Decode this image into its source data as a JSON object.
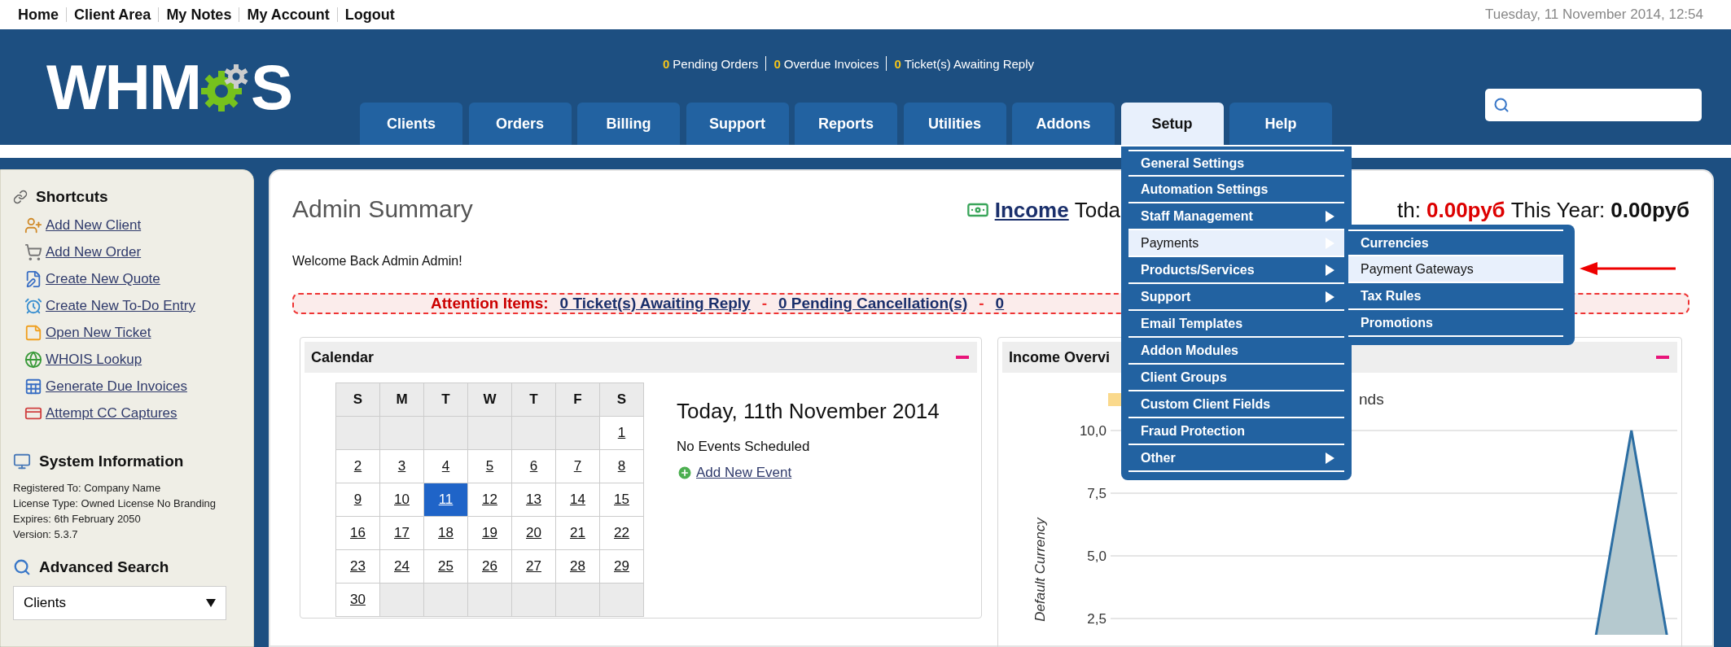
{
  "top_links": [
    "Home",
    "Client Area",
    "My Notes",
    "My Account",
    "Logout"
  ],
  "date": "Tuesday, 11 November 2014, 12:54",
  "logo": {
    "before": "WHM",
    "after": "S"
  },
  "notifications": [
    {
      "count": "0",
      "label": "Pending Orders"
    },
    {
      "count": "0",
      "label": "Overdue Invoices"
    },
    {
      "count": "0",
      "label": "Ticket(s) Awaiting Reply"
    }
  ],
  "tabs": [
    {
      "label": "Clients",
      "selected": false
    },
    {
      "label": "Orders",
      "selected": false
    },
    {
      "label": "Billing",
      "selected": false
    },
    {
      "label": "Support",
      "selected": false
    },
    {
      "label": "Reports",
      "selected": false
    },
    {
      "label": "Utilities",
      "selected": false
    },
    {
      "label": "Addons",
      "selected": false
    },
    {
      "label": "Setup",
      "selected": true
    },
    {
      "label": "Help",
      "selected": false
    }
  ],
  "setup_menu": {
    "items": [
      {
        "label": "General Settings",
        "has_submenu": false,
        "selected": false
      },
      {
        "label": "Automation Settings",
        "has_submenu": false,
        "selected": false
      },
      {
        "label": "Staff Management",
        "has_submenu": true,
        "selected": false
      },
      {
        "label": "Payments",
        "has_submenu": true,
        "selected": true
      },
      {
        "label": "Products/Services",
        "has_submenu": true,
        "selected": false
      },
      {
        "label": "Support",
        "has_submenu": true,
        "selected": false
      },
      {
        "label": "Email Templates",
        "has_submenu": false,
        "selected": false
      },
      {
        "label": "Addon Modules",
        "has_submenu": false,
        "selected": false
      },
      {
        "label": "Client Groups",
        "has_submenu": false,
        "selected": false
      },
      {
        "label": "Custom Client Fields",
        "has_submenu": false,
        "selected": false
      },
      {
        "label": "Fraud Protection",
        "has_submenu": false,
        "selected": false
      },
      {
        "label": "Other",
        "has_submenu": true,
        "selected": false
      }
    ]
  },
  "payments_submenu": {
    "items": [
      {
        "label": "Currencies",
        "selected": false
      },
      {
        "label": "Payment Gateways",
        "selected": true
      },
      {
        "label": "Tax Rules",
        "selected": false
      },
      {
        "label": "Promotions",
        "selected": false
      }
    ]
  },
  "sidebar": {
    "shortcuts": {
      "title": "Shortcuts",
      "items": [
        "Add New Client",
        "Add New Order",
        "Create New Quote",
        "Create New To-Do Entry",
        "Open New Ticket",
        "WHOIS Lookup",
        "Generate Due Invoices",
        "Attempt CC Captures"
      ]
    },
    "system_info": {
      "title": "System Information",
      "lines": [
        "Registered To: Company Name",
        "License Type: Owned License No Branding",
        "Expires: 6th February 2050",
        "Version: 5.3.7"
      ]
    },
    "advanced_search": {
      "title": "Advanced Search",
      "select_value": "Clients"
    }
  },
  "main": {
    "title": "Admin Summary",
    "income": {
      "label": "Income",
      "parts": [
        {
          "kind": "text",
          "text": "Toda"
        },
        {
          "kind": "gap"
        },
        {
          "kind": "text",
          "text": "th:"
        },
        {
          "kind": "alert_amount",
          "text": "0.00руб"
        },
        {
          "kind": "text",
          "text": "This Year:"
        },
        {
          "kind": "amount",
          "text": "0.00руб"
        }
      ]
    },
    "welcome": "Welcome Back Admin Admin!",
    "attention": {
      "label": "Attention Items:",
      "separator": "-",
      "links": [
        "0 Ticket(s) Awaiting Reply",
        "0 Pending Cancellation(s)",
        "0"
      ]
    }
  },
  "calendar": {
    "title": "Calendar",
    "weekdays": [
      "S",
      "M",
      "T",
      "W",
      "T",
      "F",
      "S"
    ],
    "weeks": [
      [
        {
          "kind": "blank"
        },
        {
          "kind": "blank"
        },
        {
          "kind": "blank"
        },
        {
          "kind": "blank"
        },
        {
          "kind": "blank"
        },
        {
          "kind": "blank"
        },
        {
          "kind": "day",
          "day": "1",
          "selected": false
        }
      ],
      [
        {
          "kind": "day",
          "day": "2",
          "selected": false
        },
        {
          "kind": "day",
          "day": "3",
          "selected": false
        },
        {
          "kind": "day",
          "day": "4",
          "selected": false
        },
        {
          "kind": "day",
          "day": "5",
          "selected": false
        },
        {
          "kind": "day",
          "day": "6",
          "selected": false
        },
        {
          "kind": "day",
          "day": "7",
          "selected": false
        },
        {
          "kind": "day",
          "day": "8",
          "selected": false
        }
      ],
      [
        {
          "kind": "day",
          "day": "9",
          "selected": false
        },
        {
          "kind": "day",
          "day": "10",
          "selected": false
        },
        {
          "kind": "day",
          "day": "11",
          "selected": true
        },
        {
          "kind": "day",
          "day": "12",
          "selected": false
        },
        {
          "kind": "day",
          "day": "13",
          "selected": false
        },
        {
          "kind": "day",
          "day": "14",
          "selected": false
        },
        {
          "kind": "day",
          "day": "15",
          "selected": false
        }
      ],
      [
        {
          "kind": "day",
          "day": "16",
          "selected": false
        },
        {
          "kind": "day",
          "day": "17",
          "selected": false
        },
        {
          "kind": "day",
          "day": "18",
          "selected": false
        },
        {
          "kind": "day",
          "day": "19",
          "selected": false
        },
        {
          "kind": "day",
          "day": "20",
          "selected": false
        },
        {
          "kind": "day",
          "day": "21",
          "selected": false
        },
        {
          "kind": "day",
          "day": "22",
          "selected": false
        }
      ],
      [
        {
          "kind": "day",
          "day": "23",
          "selected": false
        },
        {
          "kind": "day",
          "day": "24",
          "selected": false
        },
        {
          "kind": "day",
          "day": "25",
          "selected": false
        },
        {
          "kind": "day",
          "day": "26",
          "selected": false
        },
        {
          "kind": "day",
          "day": "27",
          "selected": false
        },
        {
          "kind": "day",
          "day": "28",
          "selected": false
        },
        {
          "kind": "day",
          "day": "29",
          "selected": false
        }
      ],
      [
        {
          "kind": "day",
          "day": "30",
          "selected": false
        },
        {
          "kind": "blank"
        },
        {
          "kind": "blank"
        },
        {
          "kind": "blank"
        },
        {
          "kind": "blank"
        },
        {
          "kind": "blank"
        },
        {
          "kind": "blank"
        }
      ]
    ],
    "today_heading": "Today, 11th November 2014",
    "events_text": "No Events Scheduled",
    "add_event": "Add New Event"
  },
  "income_overview": {
    "title": "Income Overvi",
    "legend": [
      {
        "label": "nds",
        "color": "#fad98c"
      }
    ],
    "chart_data": {
      "type": "area",
      "ylabel": "Default Currency",
      "ylim": [
        0,
        10
      ],
      "grid": true,
      "yticks": [
        {
          "value": 2.5,
          "label": "2,5"
        },
        {
          "value": 5,
          "label": "5,0"
        },
        {
          "value": 7.5,
          "label": "7,5"
        },
        {
          "value": 10,
          "label": "10,0"
        }
      ],
      "series": [
        {
          "color": "#2c6ea3",
          "values": [
            0,
            0,
            0,
            0,
            0,
            0,
            0,
            0,
            0,
            0,
            0,
            0,
            10,
            0
          ]
        }
      ]
    }
  }
}
